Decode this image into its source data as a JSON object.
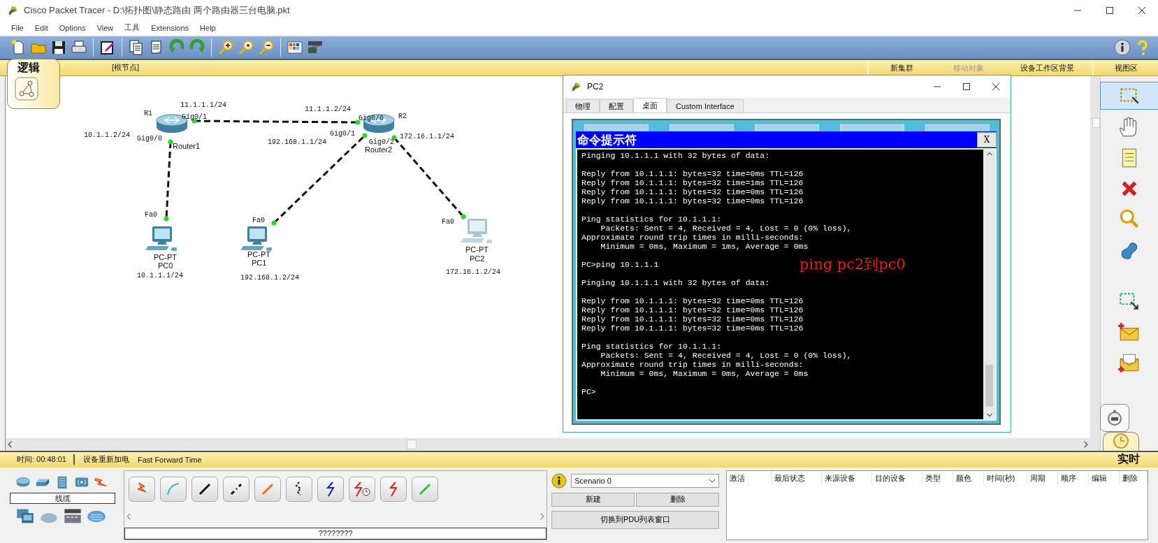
{
  "window": {
    "title": "Cisco Packet Tracer - D:\\拓扑图\\静态路由 两个路由器三台电脑.pkt"
  },
  "menu": [
    "File",
    "Edit",
    "Options",
    "View",
    "工具",
    "Extensions",
    "Help"
  ],
  "workspace_bar": {
    "tab": "逻辑",
    "path": "[根节点]",
    "actions": [
      {
        "label": "新集群",
        "disabled": false
      },
      {
        "label": "移动对象",
        "disabled": true
      },
      {
        "label": "设备工作区背景",
        "disabled": false
      },
      {
        "label": "视图区",
        "disabled": false
      }
    ]
  },
  "topology": {
    "routers": [
      {
        "hostname": "R1",
        "name": "Router1"
      },
      {
        "hostname": "R2",
        "name": "Router2"
      }
    ],
    "pcs": [
      {
        "model": "PC-PT",
        "name": "PC0",
        "address": "10.1.1.1/24",
        "faded": false
      },
      {
        "model": "PC-PT",
        "name": "PC1",
        "address": "192.168.1.2/24",
        "faded": false
      },
      {
        "model": "PC-PT",
        "name": "PC2",
        "address": "172.16.1.2/24",
        "faded": true
      }
    ],
    "ports": [
      "Gig0/1",
      "Gig0/0",
      "Gig0/0",
      "Gig0/1",
      "Gig0/2",
      "Fa0",
      "Fa0",
      "Fa0"
    ],
    "router_addresses": [
      "11.1.1.1/24",
      "10.1.1.2/24",
      "11.1.1.2/24",
      "192.168.1.1/24",
      "172.16.1.1/24"
    ]
  },
  "pc_window": {
    "title": "PC2",
    "tabs": [
      {
        "label": "物理",
        "selected": false
      },
      {
        "label": "配置",
        "selected": false
      },
      {
        "label": "桌面",
        "selected": true
      },
      {
        "label": "Custom Interface",
        "selected": false
      }
    ],
    "terminal": {
      "title": "命令提示符",
      "close": "X",
      "blocks": [
        [
          "Pinging 10.1.1.1 with 32 bytes of data:"
        ],
        [
          "Reply from 10.1.1.1: bytes=32 time=0ms TTL=126",
          "Reply from 10.1.1.1: bytes=32 time=1ms TTL=126",
          "Reply from 10.1.1.1: bytes=32 time=0ms TTL=126",
          "Reply from 10.1.1.1: bytes=32 time=0ms TTL=126"
        ],
        [
          "Ping statistics for 10.1.1.1:",
          "    Packets: Sent = 4, Received = 4, Lost = 0 (0% loss),",
          "Approximate round trip times in milli-seconds:",
          "    Minimum = 0ms, Maximum = 1ms, Average = 0ms"
        ],
        [
          "PC>ping 10.1.1.1"
        ],
        [
          "Pinging 10.1.1.1 with 32 bytes of data:"
        ],
        [
          "Reply from 10.1.1.1: bytes=32 time=0ms TTL=126",
          "Reply from 10.1.1.1: bytes=32 time=0ms TTL=126",
          "Reply from 10.1.1.1: bytes=32 time=0ms TTL=126",
          "Reply from 10.1.1.1: bytes=32 time=0ms TTL=126"
        ],
        [
          "Ping statistics for 10.1.1.1:",
          "    Packets: Sent = 4, Received = 4, Lost = 0 (0% loss),",
          "Approximate round trip times in milli-seconds:",
          "    Minimum = 0ms, Maximum = 0ms, Average = 0ms"
        ],
        [
          "PC>"
        ]
      ]
    },
    "annotation": "ping pc2到pc0"
  },
  "status_bar": {
    "time": "时间: 00:48:01",
    "power_cycle": "设备重新加电",
    "fast_forward": "Fast Forward Time",
    "mode": "实时"
  },
  "device_panel": {
    "category": "线缆"
  },
  "cable_panel": {
    "description": "????????"
  },
  "scenario": {
    "selected": "Scenario 0",
    "buttons": [
      "新建",
      "删除"
    ],
    "toggle": "切换到PDU列表窗口"
  },
  "pdu_table": {
    "columns": [
      "激活",
      "最后状态",
      "来源设备",
      "目的设备",
      "类型",
      "颜色",
      "时间(秒)",
      "周期",
      "顺序",
      "编辑",
      "删除"
    ]
  }
}
